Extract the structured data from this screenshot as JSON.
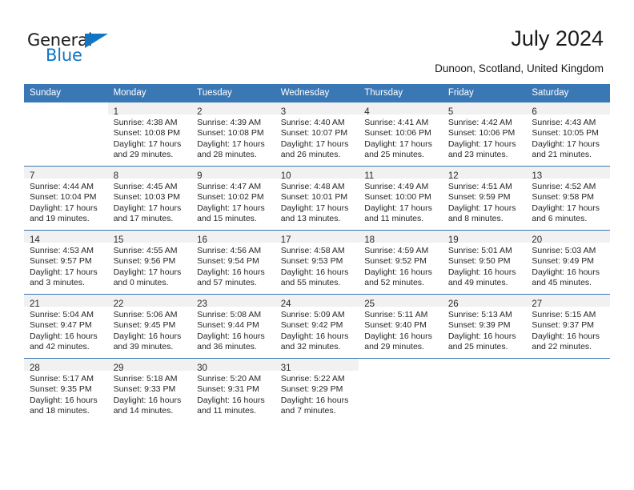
{
  "brand": {
    "name_part1": "General",
    "name_part2": "Blue",
    "accent_color": "#1275c4"
  },
  "header": {
    "title": "July 2024",
    "location": "Dunoon, Scotland, United Kingdom"
  },
  "calendar": {
    "header_bg": "#3a78b5",
    "daynum_bg": "#f1f1f1",
    "weekdays": [
      "Sunday",
      "Monday",
      "Tuesday",
      "Wednesday",
      "Thursday",
      "Friday",
      "Saturday"
    ],
    "weeks": [
      [
        {
          "day": "",
          "sunrise": "",
          "sunset": "",
          "daylight1": "",
          "daylight2": ""
        },
        {
          "day": "1",
          "sunrise": "Sunrise: 4:38 AM",
          "sunset": "Sunset: 10:08 PM",
          "daylight1": "Daylight: 17 hours",
          "daylight2": "and 29 minutes."
        },
        {
          "day": "2",
          "sunrise": "Sunrise: 4:39 AM",
          "sunset": "Sunset: 10:08 PM",
          "daylight1": "Daylight: 17 hours",
          "daylight2": "and 28 minutes."
        },
        {
          "day": "3",
          "sunrise": "Sunrise: 4:40 AM",
          "sunset": "Sunset: 10:07 PM",
          "daylight1": "Daylight: 17 hours",
          "daylight2": "and 26 minutes."
        },
        {
          "day": "4",
          "sunrise": "Sunrise: 4:41 AM",
          "sunset": "Sunset: 10:06 PM",
          "daylight1": "Daylight: 17 hours",
          "daylight2": "and 25 minutes."
        },
        {
          "day": "5",
          "sunrise": "Sunrise: 4:42 AM",
          "sunset": "Sunset: 10:06 PM",
          "daylight1": "Daylight: 17 hours",
          "daylight2": "and 23 minutes."
        },
        {
          "day": "6",
          "sunrise": "Sunrise: 4:43 AM",
          "sunset": "Sunset: 10:05 PM",
          "daylight1": "Daylight: 17 hours",
          "daylight2": "and 21 minutes."
        }
      ],
      [
        {
          "day": "7",
          "sunrise": "Sunrise: 4:44 AM",
          "sunset": "Sunset: 10:04 PM",
          "daylight1": "Daylight: 17 hours",
          "daylight2": "and 19 minutes."
        },
        {
          "day": "8",
          "sunrise": "Sunrise: 4:45 AM",
          "sunset": "Sunset: 10:03 PM",
          "daylight1": "Daylight: 17 hours",
          "daylight2": "and 17 minutes."
        },
        {
          "day": "9",
          "sunrise": "Sunrise: 4:47 AM",
          "sunset": "Sunset: 10:02 PM",
          "daylight1": "Daylight: 17 hours",
          "daylight2": "and 15 minutes."
        },
        {
          "day": "10",
          "sunrise": "Sunrise: 4:48 AM",
          "sunset": "Sunset: 10:01 PM",
          "daylight1": "Daylight: 17 hours",
          "daylight2": "and 13 minutes."
        },
        {
          "day": "11",
          "sunrise": "Sunrise: 4:49 AM",
          "sunset": "Sunset: 10:00 PM",
          "daylight1": "Daylight: 17 hours",
          "daylight2": "and 11 minutes."
        },
        {
          "day": "12",
          "sunrise": "Sunrise: 4:51 AM",
          "sunset": "Sunset: 9:59 PM",
          "daylight1": "Daylight: 17 hours",
          "daylight2": "and 8 minutes."
        },
        {
          "day": "13",
          "sunrise": "Sunrise: 4:52 AM",
          "sunset": "Sunset: 9:58 PM",
          "daylight1": "Daylight: 17 hours",
          "daylight2": "and 6 minutes."
        }
      ],
      [
        {
          "day": "14",
          "sunrise": "Sunrise: 4:53 AM",
          "sunset": "Sunset: 9:57 PM",
          "daylight1": "Daylight: 17 hours",
          "daylight2": "and 3 minutes."
        },
        {
          "day": "15",
          "sunrise": "Sunrise: 4:55 AM",
          "sunset": "Sunset: 9:56 PM",
          "daylight1": "Daylight: 17 hours",
          "daylight2": "and 0 minutes."
        },
        {
          "day": "16",
          "sunrise": "Sunrise: 4:56 AM",
          "sunset": "Sunset: 9:54 PM",
          "daylight1": "Daylight: 16 hours",
          "daylight2": "and 57 minutes."
        },
        {
          "day": "17",
          "sunrise": "Sunrise: 4:58 AM",
          "sunset": "Sunset: 9:53 PM",
          "daylight1": "Daylight: 16 hours",
          "daylight2": "and 55 minutes."
        },
        {
          "day": "18",
          "sunrise": "Sunrise: 4:59 AM",
          "sunset": "Sunset: 9:52 PM",
          "daylight1": "Daylight: 16 hours",
          "daylight2": "and 52 minutes."
        },
        {
          "day": "19",
          "sunrise": "Sunrise: 5:01 AM",
          "sunset": "Sunset: 9:50 PM",
          "daylight1": "Daylight: 16 hours",
          "daylight2": "and 49 minutes."
        },
        {
          "day": "20",
          "sunrise": "Sunrise: 5:03 AM",
          "sunset": "Sunset: 9:49 PM",
          "daylight1": "Daylight: 16 hours",
          "daylight2": "and 45 minutes."
        }
      ],
      [
        {
          "day": "21",
          "sunrise": "Sunrise: 5:04 AM",
          "sunset": "Sunset: 9:47 PM",
          "daylight1": "Daylight: 16 hours",
          "daylight2": "and 42 minutes."
        },
        {
          "day": "22",
          "sunrise": "Sunrise: 5:06 AM",
          "sunset": "Sunset: 9:45 PM",
          "daylight1": "Daylight: 16 hours",
          "daylight2": "and 39 minutes."
        },
        {
          "day": "23",
          "sunrise": "Sunrise: 5:08 AM",
          "sunset": "Sunset: 9:44 PM",
          "daylight1": "Daylight: 16 hours",
          "daylight2": "and 36 minutes."
        },
        {
          "day": "24",
          "sunrise": "Sunrise: 5:09 AM",
          "sunset": "Sunset: 9:42 PM",
          "daylight1": "Daylight: 16 hours",
          "daylight2": "and 32 minutes."
        },
        {
          "day": "25",
          "sunrise": "Sunrise: 5:11 AM",
          "sunset": "Sunset: 9:40 PM",
          "daylight1": "Daylight: 16 hours",
          "daylight2": "and 29 minutes."
        },
        {
          "day": "26",
          "sunrise": "Sunrise: 5:13 AM",
          "sunset": "Sunset: 9:39 PM",
          "daylight1": "Daylight: 16 hours",
          "daylight2": "and 25 minutes."
        },
        {
          "day": "27",
          "sunrise": "Sunrise: 5:15 AM",
          "sunset": "Sunset: 9:37 PM",
          "daylight1": "Daylight: 16 hours",
          "daylight2": "and 22 minutes."
        }
      ],
      [
        {
          "day": "28",
          "sunrise": "Sunrise: 5:17 AM",
          "sunset": "Sunset: 9:35 PM",
          "daylight1": "Daylight: 16 hours",
          "daylight2": "and 18 minutes."
        },
        {
          "day": "29",
          "sunrise": "Sunrise: 5:18 AM",
          "sunset": "Sunset: 9:33 PM",
          "daylight1": "Daylight: 16 hours",
          "daylight2": "and 14 minutes."
        },
        {
          "day": "30",
          "sunrise": "Sunrise: 5:20 AM",
          "sunset": "Sunset: 9:31 PM",
          "daylight1": "Daylight: 16 hours",
          "daylight2": "and 11 minutes."
        },
        {
          "day": "31",
          "sunrise": "Sunrise: 5:22 AM",
          "sunset": "Sunset: 9:29 PM",
          "daylight1": "Daylight: 16 hours",
          "daylight2": "and 7 minutes."
        },
        {
          "day": "",
          "sunrise": "",
          "sunset": "",
          "daylight1": "",
          "daylight2": ""
        },
        {
          "day": "",
          "sunrise": "",
          "sunset": "",
          "daylight1": "",
          "daylight2": ""
        },
        {
          "day": "",
          "sunrise": "",
          "sunset": "",
          "daylight1": "",
          "daylight2": ""
        }
      ]
    ]
  }
}
